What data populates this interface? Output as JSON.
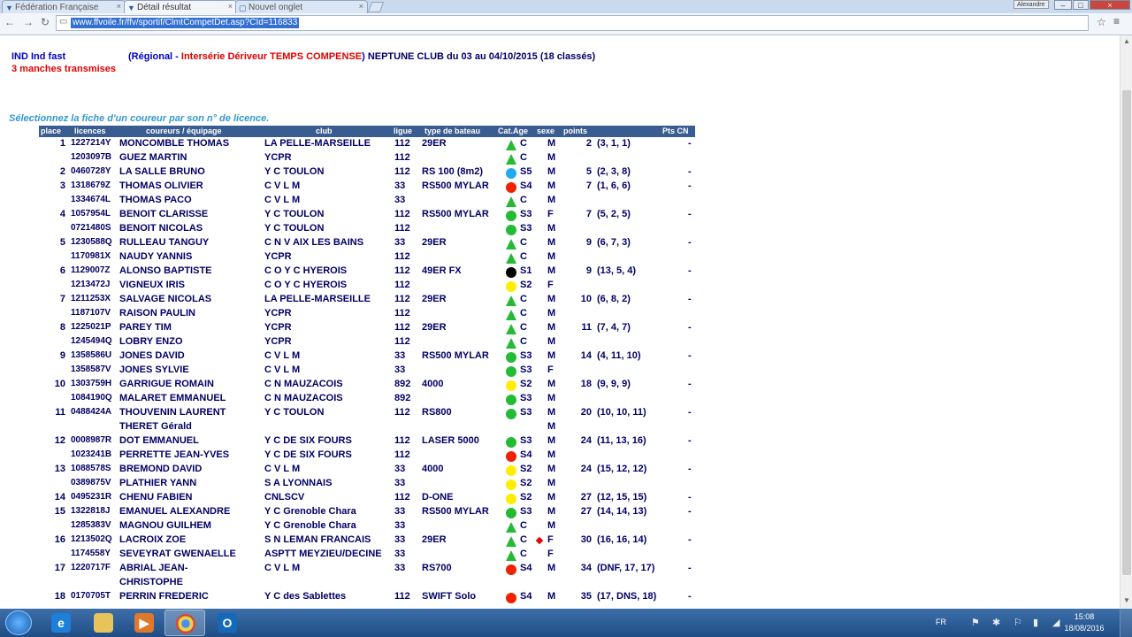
{
  "browser": {
    "tabs": [
      {
        "label": "Fédération Française",
        "close": "×"
      },
      {
        "label": "Détail résultat",
        "close": "×"
      },
      {
        "label": "Nouvel onglet",
        "close": "×"
      }
    ],
    "url": "www.ffvoile.fr/ffv/sportif/ClmtCompetDet.asp?CId=116833",
    "user_badge": "Alexandre",
    "window_controls": [
      "–",
      "□",
      "×"
    ]
  },
  "header": {
    "line1_blue": "IND Ind fast",
    "line2_red": "3 manches transmises",
    "open_paren": "(Régional - ",
    "intro_red": "Intersérie Dériveur TEMPS COMPENSE",
    "close_paren": ")",
    "club_navy": "NEPTUNE CLUB",
    "dates_navy": "du 03 au 04/10/2015 (18 classés)"
  },
  "instruction": "Sélectionnez la fiche d'un coureur par son n° de licence.",
  "columns": {
    "place": "place",
    "licence": "licences",
    "name": "coureurs / équipage",
    "club": "club",
    "ligue": "ligue",
    "boat": "type de bateau",
    "cat": "Cat.Age",
    "sexe": "sexe",
    "points": "points",
    "cn": "Pts CN"
  },
  "icon_colors": {
    "green": "#22bb33",
    "cyan": "#22aaee",
    "red": "#ee2200",
    "yellow": "#ffee00",
    "black": "#000000"
  },
  "rows": [
    {
      "place": "1",
      "lic": "1227214Y",
      "name": "MONCOMBLE THOMAS",
      "club": "LA PELLE-MARSEILLE",
      "ligue": "112",
      "boat": "29ER",
      "icon": "tri",
      "cat": "C",
      "sexe": "M",
      "pts": "2",
      "det": "(3, 1, 1)",
      "cn": "-"
    },
    {
      "place": "",
      "lic": "1203097B",
      "name": "GUEZ MARTIN",
      "club": "YCPR",
      "ligue": "112",
      "boat": "",
      "icon": "tri",
      "cat": "C",
      "sexe": "M",
      "pts": "",
      "det": "",
      "cn": ""
    },
    {
      "place": "2",
      "lic": "0460728Y",
      "name": "LA SALLE BRUNO",
      "club": "Y C TOULON",
      "ligue": "112",
      "boat": "RS 100 (8m2)",
      "icon": "cyan",
      "cat": "S5",
      "sexe": "M",
      "pts": "5",
      "det": "(2, 3, 8)",
      "cn": "-"
    },
    {
      "place": "3",
      "lic": "1318679Z",
      "name": "THOMAS OLIVIER",
      "club": "C V L M",
      "ligue": "33",
      "boat": "RS500 MYLAR",
      "icon": "red",
      "cat": "S4",
      "sexe": "M",
      "pts": "7",
      "det": "(1, 6, 6)",
      "cn": "-"
    },
    {
      "place": "",
      "lic": "1334674L",
      "name": "THOMAS PACO",
      "club": "C V L M",
      "ligue": "33",
      "boat": "",
      "icon": "tri",
      "cat": "C",
      "sexe": "M",
      "pts": "",
      "det": "",
      "cn": ""
    },
    {
      "place": "4",
      "lic": "1057954L",
      "name": "BENOIT CLARISSE",
      "club": "Y C TOULON",
      "ligue": "112",
      "boat": "RS500 MYLAR",
      "icon": "green",
      "cat": "S3",
      "sexe": "F",
      "pts": "7",
      "det": "(5, 2, 5)",
      "cn": "-"
    },
    {
      "place": "",
      "lic": "0721480S",
      "name": "BENOIT NICOLAS",
      "club": "Y C TOULON",
      "ligue": "112",
      "boat": "",
      "icon": "green",
      "cat": "S3",
      "sexe": "M",
      "pts": "",
      "det": "",
      "cn": ""
    },
    {
      "place": "5",
      "lic": "1230588Q",
      "name": "RULLEAU TANGUY",
      "club": "C N V AIX LES BAINS",
      "ligue": "33",
      "boat": "29ER",
      "icon": "tri",
      "cat": "C",
      "sexe": "M",
      "pts": "9",
      "det": "(6, 7, 3)",
      "cn": "-"
    },
    {
      "place": "",
      "lic": "1170981X",
      "name": "NAUDY YANNIS",
      "club": "YCPR",
      "ligue": "112",
      "boat": "",
      "icon": "tri",
      "cat": "C",
      "sexe": "M",
      "pts": "",
      "det": "",
      "cn": ""
    },
    {
      "place": "6",
      "lic": "1129007Z",
      "name": "ALONSO BAPTISTE",
      "club": "C O Y C HYEROIS",
      "ligue": "112",
      "boat": "49ER FX",
      "icon": "black",
      "cat": "S1",
      "sexe": "M",
      "pts": "9",
      "det": "(13, 5, 4)",
      "cn": "-"
    },
    {
      "place": "",
      "lic": "1213472J",
      "name": "VIGNEUX IRIS",
      "club": "C O Y C HYEROIS",
      "ligue": "112",
      "boat": "",
      "icon": "yellow",
      "cat": "S2",
      "sexe": "F",
      "pts": "",
      "det": "",
      "cn": ""
    },
    {
      "place": "7",
      "lic": "1211253X",
      "name": "SALVAGE NICOLAS",
      "club": "LA PELLE-MARSEILLE",
      "ligue": "112",
      "boat": "29ER",
      "icon": "tri",
      "cat": "C",
      "sexe": "M",
      "pts": "10",
      "det": "(6, 8, 2)",
      "cn": "-"
    },
    {
      "place": "",
      "lic": "1187107V",
      "name": "RAISON PAULIN",
      "club": "YCPR",
      "ligue": "112",
      "boat": "",
      "icon": "tri",
      "cat": "C",
      "sexe": "M",
      "pts": "",
      "det": "",
      "cn": ""
    },
    {
      "place": "8",
      "lic": "1225021P",
      "name": "PAREY TIM",
      "club": "YCPR",
      "ligue": "112",
      "boat": "29ER",
      "icon": "tri",
      "cat": "C",
      "sexe": "M",
      "pts": "11",
      "det": "(7, 4, 7)",
      "cn": "-"
    },
    {
      "place": "",
      "lic": "1245494Q",
      "name": "LOBRY ENZO",
      "club": "YCPR",
      "ligue": "112",
      "boat": "",
      "icon": "tri",
      "cat": "C",
      "sexe": "M",
      "pts": "",
      "det": "",
      "cn": ""
    },
    {
      "place": "9",
      "lic": "1358586U",
      "name": "JONES DAVID",
      "club": "C V L M",
      "ligue": "33",
      "boat": "RS500 MYLAR",
      "icon": "green",
      "cat": "S3",
      "sexe": "M",
      "pts": "14",
      "det": "(4, 11, 10)",
      "cn": "-"
    },
    {
      "place": "",
      "lic": "1358587V",
      "name": "JONES SYLVIE",
      "club": "C V L M",
      "ligue": "33",
      "boat": "",
      "icon": "green",
      "cat": "S3",
      "sexe": "F",
      "pts": "",
      "det": "",
      "cn": ""
    },
    {
      "place": "10",
      "lic": "1303759H",
      "name": "GARRIGUE ROMAIN",
      "club": "C N MAUZACOIS",
      "ligue": "892",
      "boat": "4000",
      "icon": "yellow",
      "cat": "S2",
      "sexe": "M",
      "pts": "18",
      "det": "(9, 9, 9)",
      "cn": "-"
    },
    {
      "place": "",
      "lic": "1084190Q",
      "name": "MALARET EMMANUEL",
      "club": "C N MAUZACOIS",
      "ligue": "892",
      "boat": "",
      "icon": "green",
      "cat": "S3",
      "sexe": "M",
      "pts": "",
      "det": "",
      "cn": ""
    },
    {
      "place": "11",
      "lic": "0488424A",
      "name": "THOUVENIN LAURENT",
      "club": "Y C TOULON",
      "ligue": "112",
      "boat": "RS800",
      "icon": "green",
      "cat": "S3",
      "sexe": "M",
      "pts": "20",
      "det": "(10, 10, 11)",
      "cn": "-"
    },
    {
      "place": "",
      "lic": "",
      "name": "THERET Gérald",
      "club": "",
      "ligue": "",
      "boat": "",
      "icon": "",
      "cat": "",
      "sexe": "M",
      "pts": "",
      "det": "",
      "cn": ""
    },
    {
      "place": "12",
      "lic": "0008987R",
      "name": "DOT EMMANUEL",
      "club": "Y C DE SIX FOURS",
      "ligue": "112",
      "boat": "LASER 5000",
      "icon": "green",
      "cat": "S3",
      "sexe": "M",
      "pts": "24",
      "det": "(11, 13, 16)",
      "cn": "-"
    },
    {
      "place": "",
      "lic": "1023241B",
      "name": "PERRETTE JEAN-YVES",
      "club": "Y C DE SIX FOURS",
      "ligue": "112",
      "boat": "",
      "icon": "red",
      "cat": "S4",
      "sexe": "M",
      "pts": "",
      "det": "",
      "cn": ""
    },
    {
      "place": "13",
      "lic": "1088578S",
      "name": "BREMOND DAVID",
      "club": "C V L M",
      "ligue": "33",
      "boat": "4000",
      "icon": "yellow",
      "cat": "S2",
      "sexe": "M",
      "pts": "24",
      "det": "(15, 12, 12)",
      "cn": "-"
    },
    {
      "place": "",
      "lic": "0389875V",
      "name": "PLATHIER YANN",
      "club": "S A LYONNAIS",
      "ligue": "33",
      "boat": "",
      "icon": "yellow",
      "cat": "S2",
      "sexe": "M",
      "pts": "",
      "det": "",
      "cn": ""
    },
    {
      "place": "14",
      "lic": "0495231R",
      "name": "CHENU FABIEN",
      "club": "CNLSCV",
      "ligue": "112",
      "boat": "D-ONE",
      "icon": "yellow",
      "cat": "S2",
      "sexe": "M",
      "pts": "27",
      "det": "(12, 15, 15)",
      "cn": "-"
    },
    {
      "place": "15",
      "lic": "1322818J",
      "name": "EMANUEL ALEXANDRE",
      "club": "Y C Grenoble Chara",
      "ligue": "33",
      "boat": "RS500 MYLAR",
      "icon": "green",
      "cat": "S3",
      "sexe": "M",
      "pts": "27",
      "det": "(14, 14, 13)",
      "cn": "-"
    },
    {
      "place": "",
      "lic": "1285383V",
      "name": "MAGNOU GUILHEM",
      "club": "Y C Grenoble Chara",
      "ligue": "33",
      "boat": "",
      "icon": "tri",
      "cat": "C",
      "sexe": "M",
      "pts": "",
      "det": "",
      "cn": ""
    },
    {
      "place": "16",
      "lic": "1213502Q",
      "name": "LACROIX ZOE",
      "club": "S N LEMAN FRANCAIS",
      "ligue": "33",
      "boat": "29ER",
      "icon": "tri",
      "cat": "C",
      "sexe": "F",
      "pts": "30",
      "det": "(16, 16, 14)",
      "cn": "-",
      "extra": "diamond"
    },
    {
      "place": "",
      "lic": "1174558Y",
      "name": "SEVEYRAT GWENAELLE",
      "club": "ASPTT MEYZIEU/DECINE",
      "ligue": "33",
      "boat": "",
      "icon": "tri",
      "cat": "C",
      "sexe": "F",
      "pts": "",
      "det": "",
      "cn": ""
    },
    {
      "place": "17",
      "lic": "1220717F",
      "name": "ABRIAL JEAN-",
      "club": "C V L M",
      "ligue": "33",
      "boat": "RS700",
      "icon": "red",
      "cat": "S4",
      "sexe": "M",
      "pts": "34",
      "det": "(DNF, 17, 17)",
      "cn": "-"
    },
    {
      "place": "",
      "lic": "",
      "name": "CHRISTOPHE",
      "club": "",
      "ligue": "",
      "boat": "",
      "icon": "",
      "cat": "",
      "sexe": "",
      "pts": "",
      "det": "",
      "cn": ""
    },
    {
      "place": "18",
      "lic": "0170705T",
      "name": "PERRIN FREDERIC",
      "club": "Y C des Sablettes",
      "ligue": "112",
      "boat": "SWIFT Solo",
      "icon": "red",
      "cat": "S4",
      "sexe": "M",
      "pts": "35",
      "det": "(17, DNS, 18)",
      "cn": "-"
    }
  ],
  "taskbar": {
    "lang": "FR",
    "time": "15:08",
    "date": "18/08/2016"
  }
}
